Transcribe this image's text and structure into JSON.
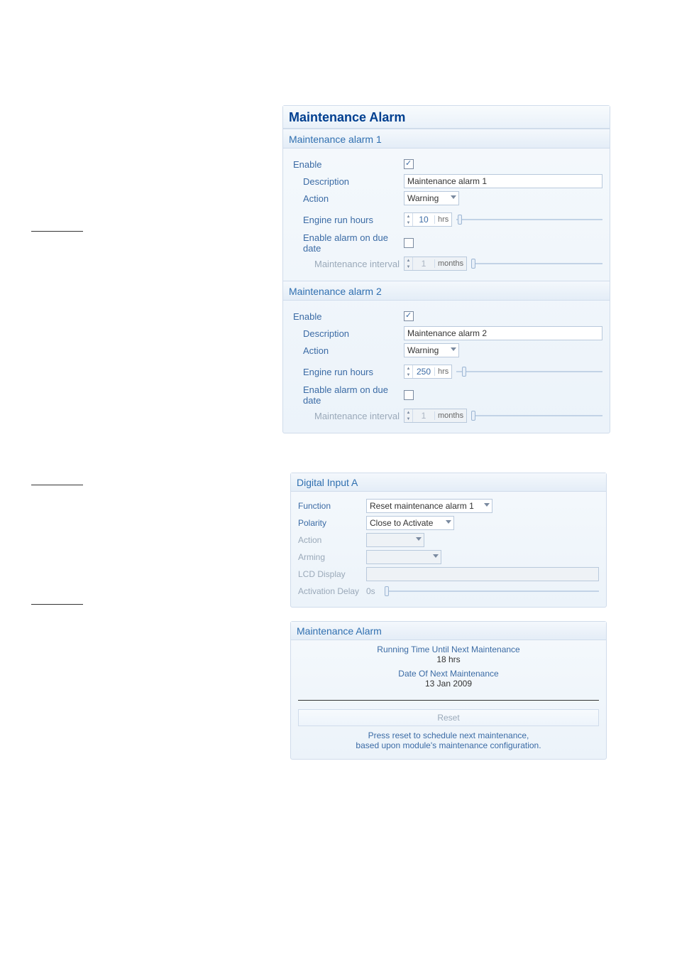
{
  "panel1": {
    "title": "Maintenance Alarm",
    "alarm1": {
      "header": "Maintenance alarm 1",
      "enable_label": "Enable",
      "enable_checked": true,
      "description_label": "Description",
      "description_value": "Maintenance alarm 1",
      "action_label": "Action",
      "action_value": "Warning",
      "run_hours_label": "Engine run hours",
      "run_hours_value": "10",
      "run_hours_unit": "hrs",
      "due_date_label": "Enable alarm on due date",
      "due_date_checked": false,
      "interval_label": "Maintenance interval",
      "interval_value": "1",
      "interval_unit": "months"
    },
    "alarm2": {
      "header": "Maintenance alarm 2",
      "enable_label": "Enable",
      "enable_checked": true,
      "description_label": "Description",
      "description_value": "Maintenance alarm 2",
      "action_label": "Action",
      "action_value": "Warning",
      "run_hours_label": "Engine run hours",
      "run_hours_value": "250",
      "run_hours_unit": "hrs",
      "due_date_label": "Enable alarm on due date",
      "due_date_checked": false,
      "interval_label": "Maintenance interval",
      "interval_value": "1",
      "interval_unit": "months"
    }
  },
  "panel2": {
    "header": "Digital Input A",
    "function_label": "Function",
    "function_value": "Reset maintenance alarm 1",
    "polarity_label": "Polarity",
    "polarity_value": "Close to Activate",
    "action_label": "Action",
    "arming_label": "Arming",
    "lcd_label": "LCD Display",
    "delay_label": "Activation Delay",
    "delay_value": "0s"
  },
  "panel3": {
    "header": "Maintenance Alarm",
    "running_label": "Running Time Until Next Maintenance",
    "running_value": "18 hrs",
    "date_label": "Date Of Next Maintenance",
    "date_value": "13 Jan 2009",
    "reset_label": "Reset",
    "help_line1": "Press reset to schedule next maintenance,",
    "help_line2": "based upon module's maintenance configuration."
  }
}
